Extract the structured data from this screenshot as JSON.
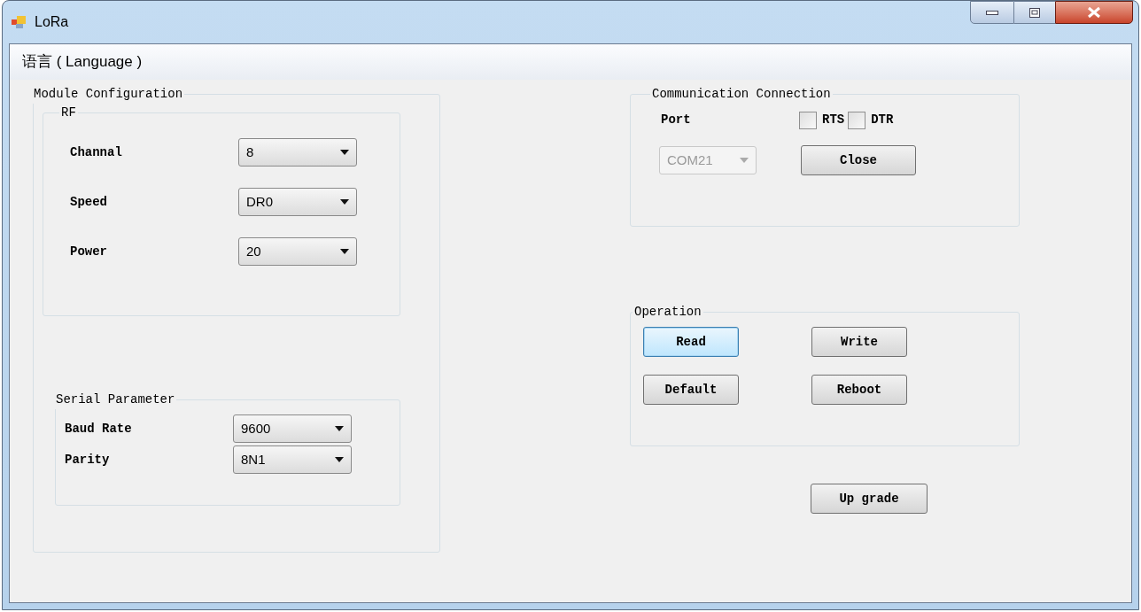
{
  "window": {
    "title": "LoRa"
  },
  "menu": [
    {
      "label": "语言 ( Language )"
    }
  ],
  "module_configuration": {
    "title": "Module Configuration",
    "rf": {
      "title": "RF",
      "fields": [
        {
          "label": "Channal",
          "value": "8",
          "disabled": false
        },
        {
          "label": "Speed",
          "value": "DR0",
          "disabled": false
        },
        {
          "label": "Power",
          "value": "20",
          "disabled": false
        }
      ]
    },
    "serial": {
      "title": "Serial Parameter",
      "fields": [
        {
          "label": "Baud Rate",
          "value": "9600",
          "disabled": false
        },
        {
          "label": "Parity",
          "value": "8N1",
          "disabled": false
        }
      ]
    }
  },
  "communication_connection": {
    "title": "Communication Connection",
    "port_label": "Port",
    "checkboxes": [
      {
        "label": "RTS",
        "checked": false
      },
      {
        "label": "DTR",
        "checked": false
      }
    ],
    "port": {
      "value": "COM21",
      "disabled": true
    },
    "button": {
      "label": "Close",
      "focused": false
    }
  },
  "operation": {
    "title": "Operation",
    "buttons": [
      {
        "label": "Read",
        "focused": true
      },
      {
        "label": "Write",
        "focused": false
      },
      {
        "label": "Default",
        "focused": false
      },
      {
        "label": "Reboot",
        "focused": false
      }
    ]
  },
  "upgrade_button": {
    "label": "Up grade",
    "focused": false
  }
}
